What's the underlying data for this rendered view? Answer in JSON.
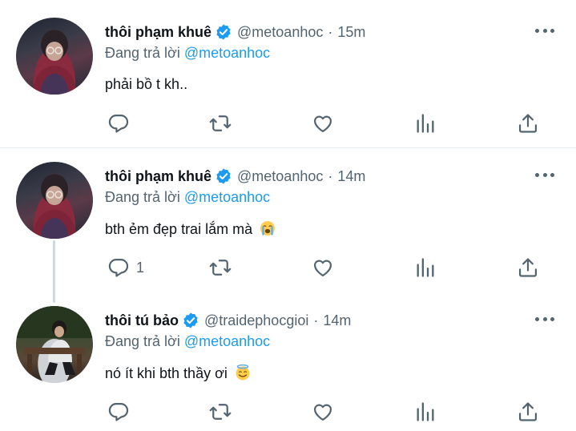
{
  "colors": {
    "accent": "#1d9bf0",
    "secondary_text": "#536471",
    "text": "#0f1419",
    "divider": "#e6ecf0"
  },
  "tweets": [
    {
      "name": "thôi phạm khuê",
      "handle": "@metoanhoc",
      "separator": "·",
      "time": "15m",
      "reply_prefix": "Đang trả lời ",
      "reply_to": "@metoanhoc",
      "text": "phải bồ t kh..",
      "emoji": "",
      "reply_count": "",
      "avatar": "avatar-photo-boy-burgundy-sweater"
    },
    {
      "name": "thôi phạm khuê",
      "handle": "@metoanhoc",
      "separator": "·",
      "time": "14m",
      "reply_prefix": "Đang trả lời ",
      "reply_to": "@metoanhoc",
      "text": "bth ẻm đẹp trai lắm mà",
      "emoji": "loudly-crying-face",
      "reply_count": "1",
      "avatar": "avatar-photo-boy-burgundy-sweater"
    },
    {
      "name": "thôi tú bảo",
      "handle": "@traidephocgioi",
      "separator": "·",
      "time": "14m",
      "reply_prefix": "Đang trả lời ",
      "reply_to": "@metoanhoc",
      "text": "nó ít khi bth thầy ơi",
      "emoji": "smiling-face-with-halo",
      "reply_count": "",
      "avatar": "avatar-photo-boy-sitting-bench"
    }
  ],
  "icons": {
    "verified": "verified-badge-icon",
    "more": "more-options-icon",
    "reply": "reply-icon",
    "retweet": "retweet-icon",
    "like": "like-icon",
    "views": "views-icon",
    "share": "share-icon"
  }
}
